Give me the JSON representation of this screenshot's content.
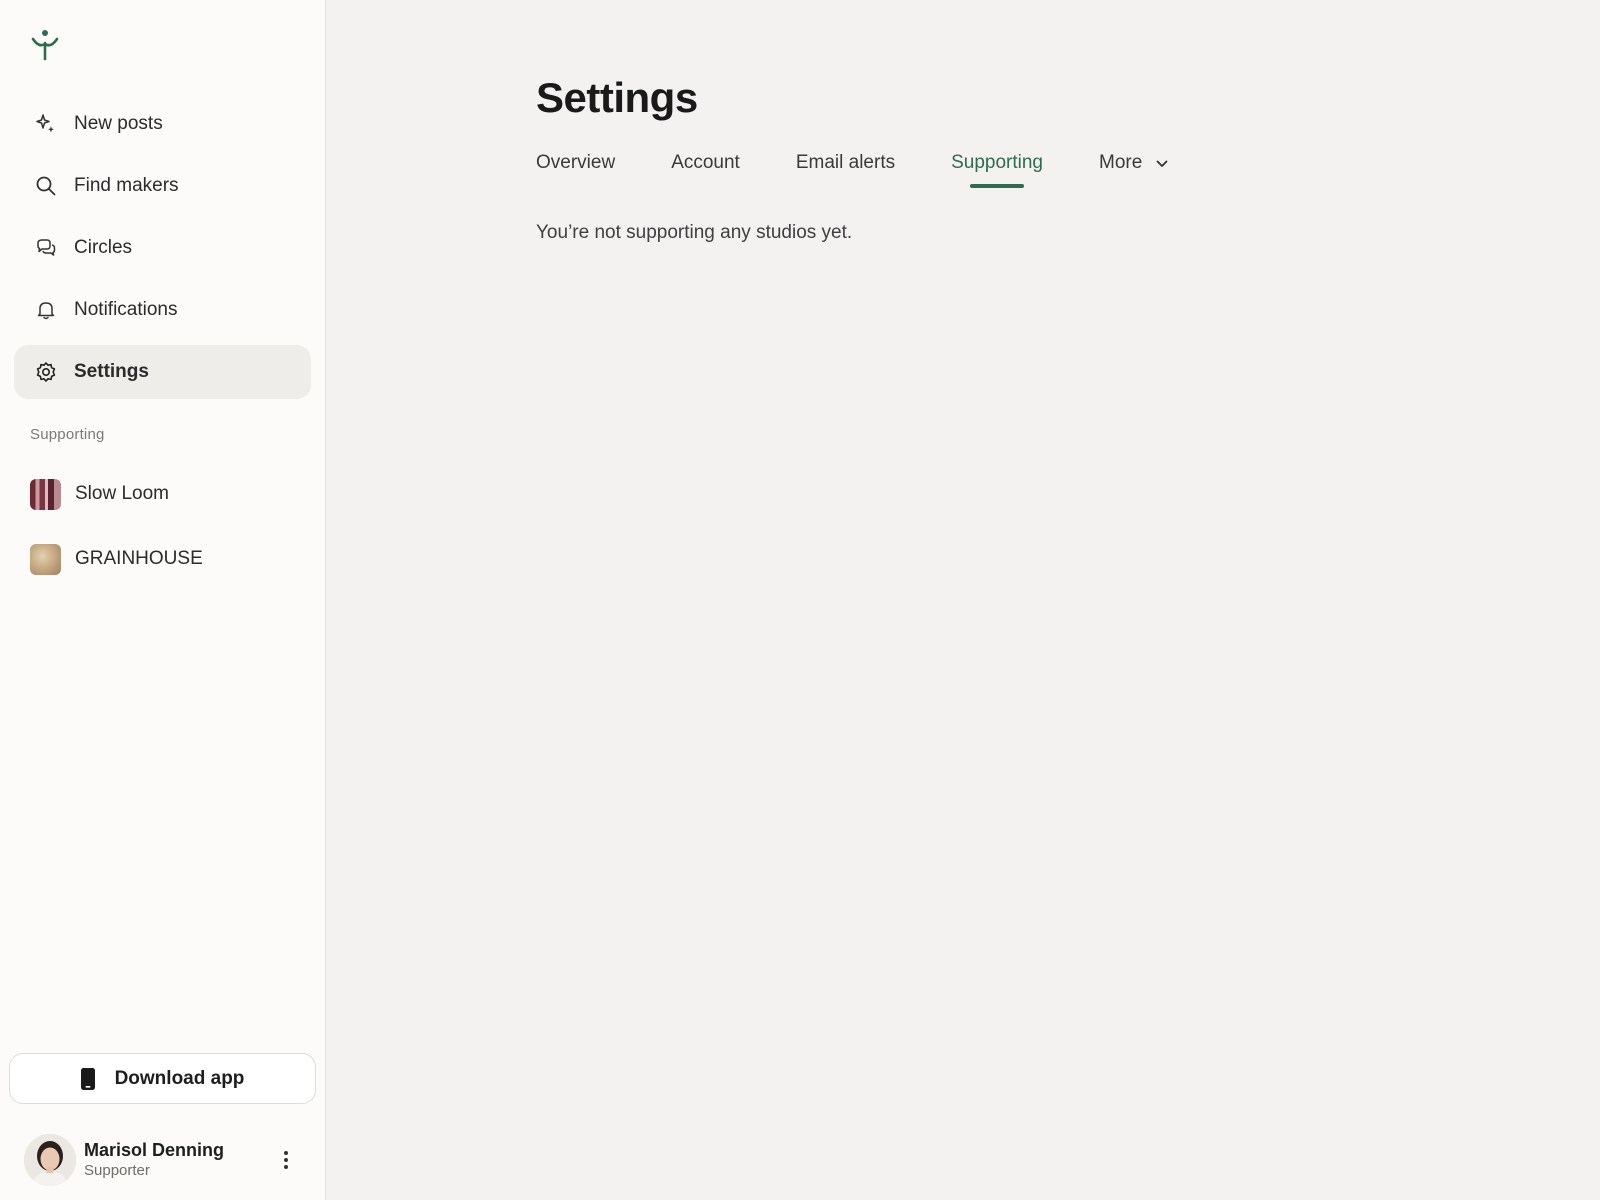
{
  "sidebar": {
    "logo_icon": "sprout-figure-icon",
    "nav": [
      {
        "label": "New posts",
        "icon": "sparkle-icon"
      },
      {
        "label": "Find makers",
        "icon": "search-icon"
      },
      {
        "label": "Circles",
        "icon": "chat-bubbles-icon"
      },
      {
        "label": "Notifications",
        "icon": "bell-icon"
      },
      {
        "label": "Settings",
        "icon": "gear-icon",
        "active": true
      }
    ],
    "section_label": "Supporting",
    "studios": [
      {
        "name": "Slow Loom"
      },
      {
        "name": "GRAINHOUSE"
      }
    ],
    "download_label": "Download app",
    "user": {
      "name": "Marisol Denning",
      "role": "Supporter"
    }
  },
  "main": {
    "title": "Settings",
    "tabs": [
      {
        "label": "Overview"
      },
      {
        "label": "Account"
      },
      {
        "label": "Email alerts"
      },
      {
        "label": "Supporting",
        "active": true
      },
      {
        "label": "More"
      }
    ],
    "empty_message": "You’re not supporting any studios yet."
  },
  "colors": {
    "accent": "#2f6b4f",
    "sidebar_bg": "#fcfbf9",
    "main_bg": "#f3f2f0",
    "active_item_bg": "#efedea"
  }
}
